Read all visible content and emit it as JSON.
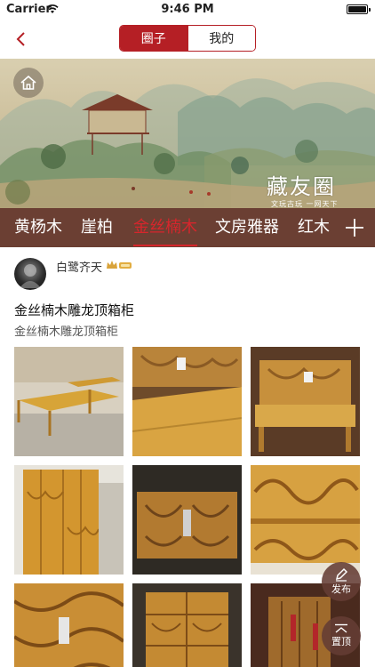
{
  "status_bar": {
    "carrier": "Carrier",
    "time": "9:46 PM"
  },
  "nav": {
    "segments": [
      {
        "label": "圈子",
        "active": true
      },
      {
        "label": "我的",
        "active": false
      }
    ],
    "accent_color": "#b51f25"
  },
  "banner": {
    "title": "藏友圈",
    "tagline": "文玩古玩 一网天下"
  },
  "categories": {
    "items": [
      "黄杨木",
      "崖柏",
      "金丝楠木",
      "文房雅器",
      "红木"
    ],
    "active": "金丝楠木",
    "active_color": "#d6262c",
    "bar_color": "#6b3f33"
  },
  "post": {
    "username": "白鹭齐天",
    "badge_icon": "vip-crown-icon",
    "title": "金丝楠木雕龙顶箱柜",
    "subtitle": "金丝楠木雕龙顶箱柜"
  },
  "fabs": {
    "publish_label": "发布",
    "top_label": "置顶"
  }
}
